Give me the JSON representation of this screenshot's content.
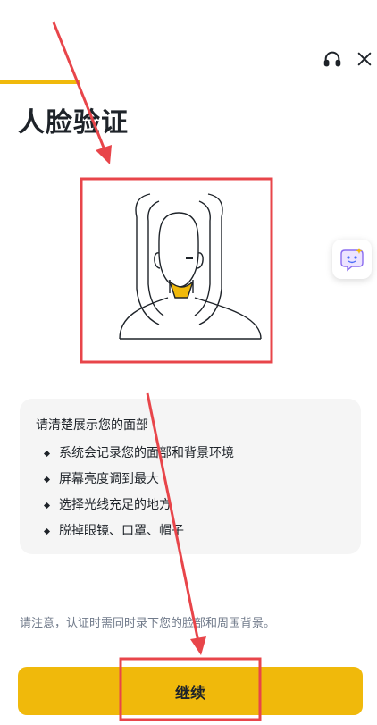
{
  "header": {
    "support_icon": "headset-icon",
    "close_icon": "close-icon",
    "progress_fraction": 0.21
  },
  "page": {
    "title": "人脸验证"
  },
  "illustration": {
    "name": "face-outline-illustration",
    "accent_color": "#F0B90B"
  },
  "assistant": {
    "icon": "ai-assistant-icon"
  },
  "tips": {
    "title": "请清楚展示您的面部",
    "items": [
      "系统会记录您的面部和背景环境",
      "屏幕亮度调到最大",
      "选择光线充足的地方",
      "脱掉眼镜、口罩、帽子"
    ]
  },
  "note": "请注意，认证时需同时录下您的脸部和周围背景。",
  "actions": {
    "continue_label": "继续",
    "accent_color": "#F0B90B"
  },
  "annotations": {
    "color": "#E8454A"
  }
}
